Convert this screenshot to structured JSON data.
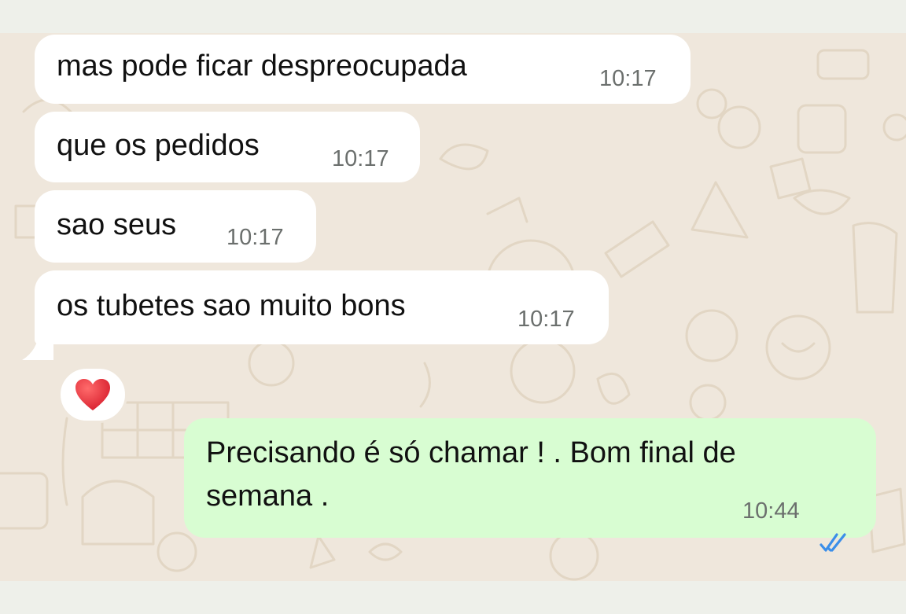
{
  "colors": {
    "incoming_bubble": "#ffffff",
    "outgoing_bubble": "#d8fdd2",
    "wallpaper": "#efe7dc",
    "read_ticks": "#3b8ee9",
    "reaction_heart": "#e02b3a"
  },
  "messages": [
    {
      "direction": "incoming",
      "text": "mas pode ficar despreocupada",
      "time": "10:17"
    },
    {
      "direction": "incoming",
      "text": "que os pedidos",
      "time": "10:17"
    },
    {
      "direction": "incoming",
      "text": "sao seus",
      "time": "10:17"
    },
    {
      "direction": "incoming",
      "text": "os tubetes sao muito bons",
      "time": "10:17",
      "reaction": "heart"
    },
    {
      "direction": "outgoing",
      "line1": "Precisando é só chamar ! . Bom final de",
      "line2": "semana .",
      "time": "10:44",
      "status_icon": "double-check-read-icon"
    }
  ]
}
